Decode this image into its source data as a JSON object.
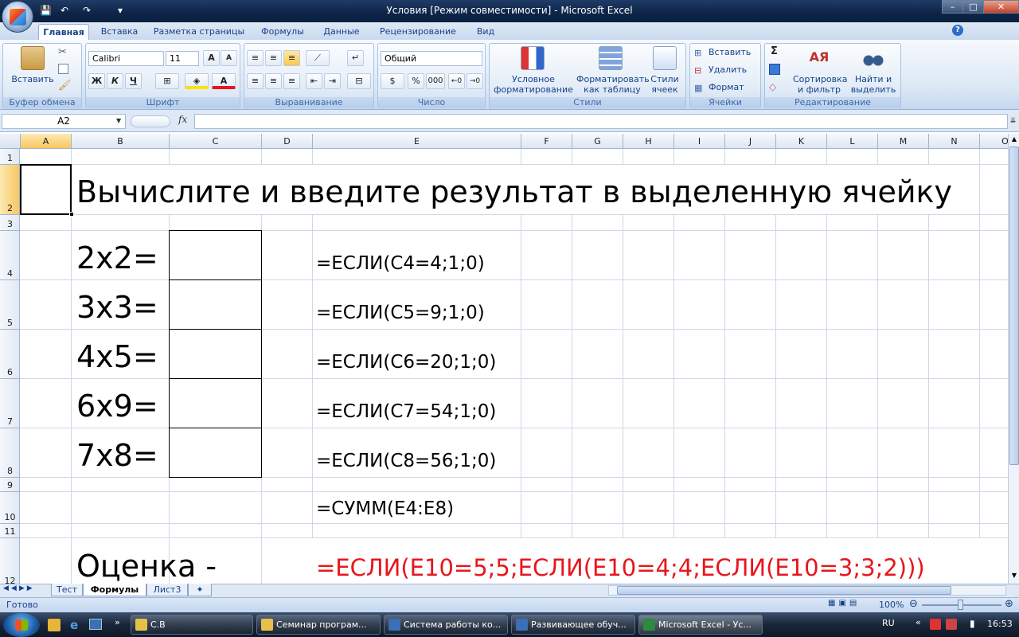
{
  "window": {
    "title": "Условия  [Режим совместимости] - Microsoft Excel",
    "min": "–",
    "max": "□",
    "close": "✕"
  },
  "qat": {
    "save": "💾",
    "undo": "↶",
    "redo": "↷",
    "dropdown": "▾"
  },
  "tabs": [
    "Главная",
    "Вставка",
    "Разметка страницы",
    "Формулы",
    "Данные",
    "Рецензирование",
    "Вид"
  ],
  "help": "?",
  "ribbon": {
    "clipboard": {
      "label": "Буфер обмена",
      "paste": "Вставить"
    },
    "font": {
      "label": "Шрифт",
      "name": "Calibri",
      "size": "11",
      "bold": "Ж",
      "italic": "К",
      "underline": "Ч"
    },
    "alignment": {
      "label": "Выравнивание"
    },
    "number": {
      "label": "Число",
      "format": "Общий",
      "percent": "%",
      "thousands": "000"
    },
    "styles": {
      "label": "Стили",
      "conditional": "Условное форматирование",
      "format_table": "Форматировать как таблицу",
      "cell_styles": "Стили ячеек"
    },
    "cells": {
      "label": "Ячейки",
      "insert": "Вставить",
      "delete": "Удалить",
      "format": "Формат"
    },
    "editing": {
      "label": "Редактирование",
      "sum": "Σ",
      "sort": "Сортировка и фильтр",
      "find": "Найти и выделить"
    }
  },
  "formula_bar": {
    "name_box": "A2",
    "fx": "fx",
    "value": ""
  },
  "columns": [
    "A",
    "B",
    "C",
    "D",
    "E",
    "F",
    "G",
    "H",
    "I",
    "J",
    "K",
    "L",
    "M",
    "N",
    "O"
  ],
  "rows": [
    "1",
    "2",
    "3",
    "4",
    "5",
    "6",
    "7",
    "8",
    "9",
    "10",
    "11",
    "12"
  ],
  "cells": {
    "title": "Вычислите и введите результат в выделенную ячейку",
    "tasks": [
      "2x2=",
      "3x3=",
      "4x5=",
      "6x9=",
      "7x8="
    ],
    "checks": [
      "=ЕСЛИ(C4=4;1;0)",
      "=ЕСЛИ(C5=9;1;0)",
      "=ЕСЛИ(C6=20;1;0)",
      "=ЕСЛИ(C7=54;1;0)",
      "=ЕСЛИ(C8=56;1;0)"
    ],
    "sum": "=СУММ(E4:E8)",
    "grade_label": "Оценка -",
    "grade_formula": "=ЕСЛИ(E10=5;5;ЕСЛИ(E10=4;4;ЕСЛИ(E10=3;3;2)))",
    "grade_color": "#e8151c"
  },
  "sheets": [
    "Тест",
    "Формулы",
    "Лист3"
  ],
  "status": {
    "ready": "Готово",
    "zoom": "100%"
  },
  "taskbar": {
    "items": [
      "С.В",
      "Семинар програм...",
      "Система работы ко...",
      "Развивающее обуч...",
      "Microsoft Excel - Ус..."
    ],
    "lang": "RU",
    "time": "16:53"
  }
}
